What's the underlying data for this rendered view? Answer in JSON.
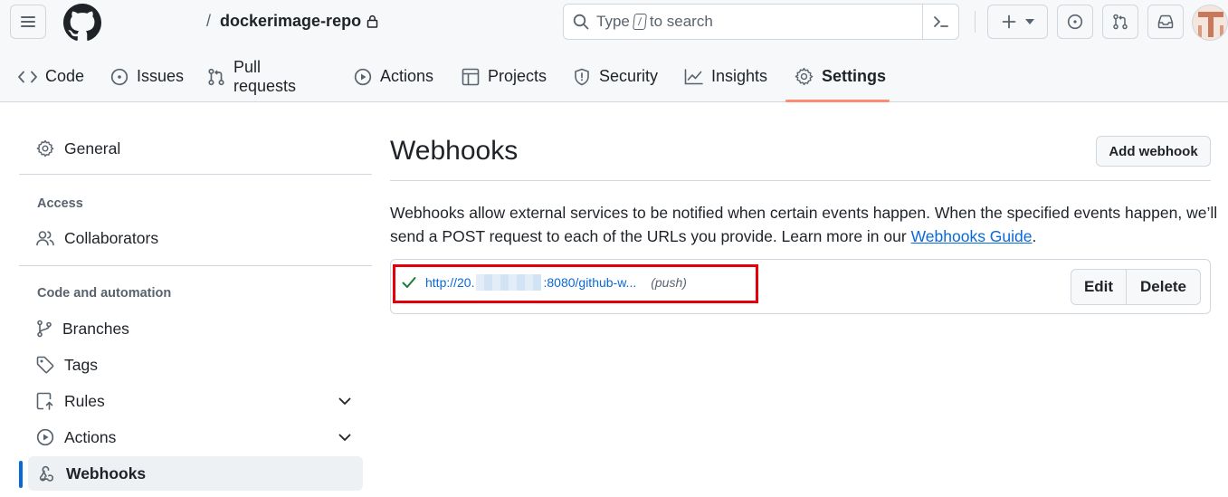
{
  "header": {
    "repo_separator": "/",
    "repo_name": "dockerimage-repo",
    "search_prefix": "Type",
    "search_key": "/",
    "search_suffix": "to search"
  },
  "tabs": [
    {
      "label": "Code",
      "icon": "code-icon"
    },
    {
      "label": "Issues",
      "icon": "issue-icon"
    },
    {
      "label": "Pull requests",
      "icon": "pull-request-icon"
    },
    {
      "label": "Actions",
      "icon": "play-icon"
    },
    {
      "label": "Projects",
      "icon": "table-icon"
    },
    {
      "label": "Security",
      "icon": "shield-icon"
    },
    {
      "label": "Insights",
      "icon": "graph-icon"
    },
    {
      "label": "Settings",
      "icon": "gear-icon",
      "active": true
    }
  ],
  "sidebar": {
    "general": "General",
    "access_heading": "Access",
    "collaborators": "Collaborators",
    "code_heading": "Code and automation",
    "branches": "Branches",
    "tags": "Tags",
    "rules": "Rules",
    "actions": "Actions",
    "webhooks": "Webhooks"
  },
  "main": {
    "title": "Webhooks",
    "add_button": "Add webhook",
    "description": "Webhooks allow external services to be notified when certain events happen. When the specified events happen, we’ll send a POST request to each of the URLs you provide. Learn more in our",
    "guide_link": "Webhooks Guide",
    "desc_end": ".",
    "hook": {
      "url_start": "http://20.",
      "url_end": ":8080/github-w...",
      "event": "(push)",
      "status": "active"
    },
    "edit_button": "Edit",
    "delete_button": "Delete"
  },
  "colors": {
    "accent": "#0969da",
    "active_tab_underline": "#fd8c73",
    "highlight_box": "#e3000b",
    "success": "#1a7f37"
  }
}
